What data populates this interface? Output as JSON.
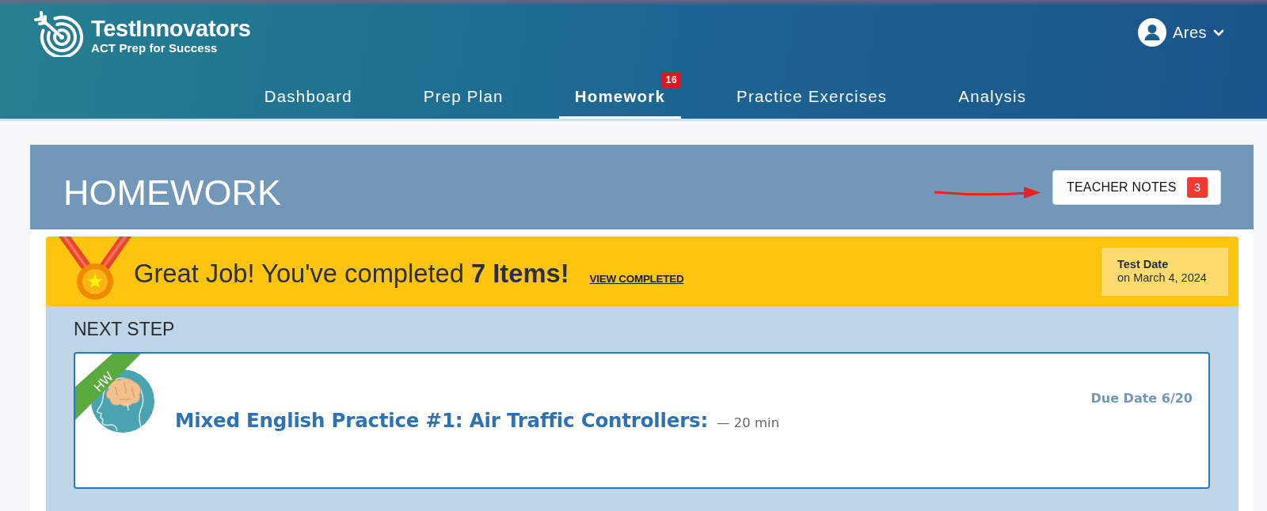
{
  "header": {
    "brand": {
      "name": "TestInnovators",
      "tagline": "ACT Prep for Success"
    },
    "user": {
      "name": "Ares"
    },
    "nav": [
      {
        "label": "Dashboard",
        "selected": false
      },
      {
        "label": "Prep Plan",
        "selected": false
      },
      {
        "label": "Homework",
        "selected": true,
        "badge": "16"
      },
      {
        "label": "Practice Exercises",
        "selected": false
      },
      {
        "label": "Analysis",
        "selected": false
      }
    ]
  },
  "page": {
    "title": "HOMEWORK",
    "teacher_notes": {
      "label": "TEACHER NOTES",
      "count": "3"
    }
  },
  "banner": {
    "message": "Great Job! You've completed **7 Items!**",
    "link": "VIEW COMPLETED",
    "test_date": {
      "label": "Test Date",
      "value": "on March 4, 2024"
    }
  },
  "next_step": {
    "heading": "NEXT STEP",
    "items": [
      {
        "tag": "HW",
        "title": "Mixed English Practice #1: Air Traffic Controllers:",
        "duration": "— 20 min",
        "due": "Due Date 6/20"
      }
    ]
  }
}
